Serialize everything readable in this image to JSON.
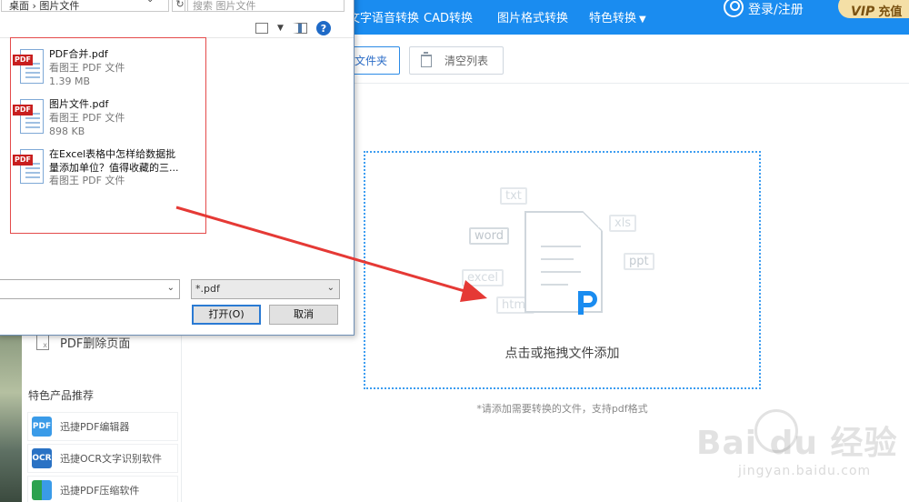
{
  "topbar": {
    "nav": [
      "文字语音转换",
      "CAD转换",
      "图片格式转换",
      "特色转换"
    ],
    "nav_dropdown_caret": "▼",
    "login": "登录/注册",
    "vip_badge": "VIP",
    "vip_label": "充值"
  },
  "toolbar": {
    "add_folder": "文件夹",
    "clear_list": "清空列表"
  },
  "sidebar": {
    "delete_pages": "PDF删除页面",
    "recommend_title": "特色产品推荐",
    "products": [
      {
        "label": "迅捷PDF编辑器",
        "icon": "pdf-editor-icon",
        "badge": "PDF"
      },
      {
        "label": "迅捷OCR文字识别软件",
        "icon": "ocr-icon",
        "badge": "OCR"
      },
      {
        "label": "迅捷PDF压缩软件",
        "icon": "compress-icon",
        "badge": ""
      }
    ]
  },
  "dropzone": {
    "prompt": "点击或拖拽文件添加",
    "hint": "*请添加需要转换的文件，支持pdf格式",
    "formats": [
      "txt",
      "xls",
      "word",
      "ppt",
      "excel",
      "html"
    ]
  },
  "dialog": {
    "breadcrumb": "桌面 › 图片文件",
    "search_placeholder": "搜索 图片文件",
    "files": [
      {
        "name": "PDF合并.pdf",
        "type": "看图王 PDF 文件",
        "size": "1.39 MB",
        "badge": "PDF"
      },
      {
        "name": "图片文件.pdf",
        "type": "看图王 PDF 文件",
        "size": "898 KB",
        "badge": "PDF"
      },
      {
        "name": "在Excel表格中怎样给数据批量添加单位？值得收藏的三...",
        "type": "看图王 PDF 文件",
        "size": "",
        "badge": "PDF"
      }
    ],
    "filename_value": "",
    "filter_value": "*.pdf",
    "open_button": "打开(O)",
    "cancel_button": "取消"
  },
  "watermark": {
    "logo": "Bai du 经验",
    "url": "jingyan.baidu.com"
  },
  "colors": {
    "topbar": "#1a8cf0",
    "accent": "#2b8ae6",
    "selection_box": "#e44a4a",
    "arrow": "#e53935",
    "vip": "#f4dfa6"
  }
}
